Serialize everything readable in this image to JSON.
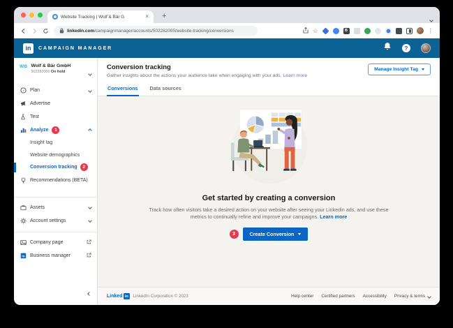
{
  "colors": {
    "header_blue": "#0c6295",
    "accent_blue": "#0a66c2",
    "badge_red": "#e9374d",
    "empty_bg": "#f5f3f0"
  },
  "browser": {
    "tab": {
      "title": "Website Tracking | Wolf & Bär G",
      "close": "×"
    },
    "new_tab": "+",
    "url": {
      "domain": "linkedin.com",
      "path": "/campaignmanager/accounts/502282005/website-tracking/conversions"
    },
    "star_glyph": "☆",
    "menu_glyph": "⋮",
    "extension_b_label": "B"
  },
  "app_header": {
    "logo": "in",
    "title": "CAMPAIGN MANAGER",
    "help": "?"
  },
  "sidebar": {
    "account": {
      "logo": "WB",
      "name": "Wolf & Bär GmbH",
      "id": "502282005",
      "status": "On hold"
    },
    "nav": [
      {
        "label": "Plan"
      },
      {
        "label": "Advertise"
      },
      {
        "label": "Test"
      },
      {
        "label": "Analyze",
        "badge": "1"
      }
    ],
    "analyze_sub": [
      {
        "label": "Insight tag"
      },
      {
        "label": "Website demographics"
      },
      {
        "label": "Conversion tracking",
        "badge": "2"
      }
    ],
    "recommendations": {
      "label": "Recommendations (BETA)"
    },
    "secondary": [
      {
        "label": "Assets"
      },
      {
        "label": "Account settings"
      }
    ],
    "external": [
      {
        "label": "Company page"
      },
      {
        "label": "Business manager"
      }
    ]
  },
  "page": {
    "title": "Conversion tracking",
    "subtitle": "Gather insights about the actions your audience take when engaging with your ads.",
    "learn_more": "Learn more",
    "manage_button": "Manage Insight Tag",
    "tabs": [
      {
        "label": "Conversions"
      },
      {
        "label": "Data sources"
      }
    ]
  },
  "empty_state": {
    "heading": "Get started by creating a conversion",
    "body": "Track how often visitors take a desired action on your website after seeing your Linkedin ads, and use these metrics to continually refine and improve your campaigns.",
    "learn_more": "Learn more",
    "step_badge": "3",
    "cta": "Create Conversion"
  },
  "footer": {
    "logo_word": "Linked",
    "logo_in": "in",
    "copyright": "LinkedIn Corporation © 2023",
    "links": [
      {
        "label": "Help center"
      },
      {
        "label": "Certified partners"
      },
      {
        "label": "Accessibility"
      },
      {
        "label": "Privacy & terms"
      }
    ]
  }
}
